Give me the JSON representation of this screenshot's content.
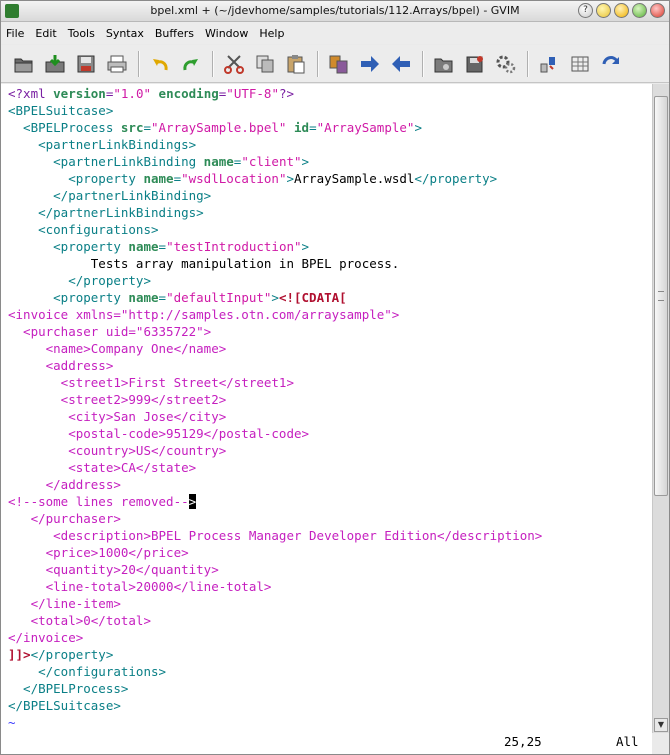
{
  "window": {
    "title": "bpel.xml + (~/jdevhome/samples/tutorials/112.Arrays/bpel) - GVIM"
  },
  "menu": [
    {
      "label": "File"
    },
    {
      "label": "Edit"
    },
    {
      "label": "Tools"
    },
    {
      "label": "Syntax"
    },
    {
      "label": "Buffers"
    },
    {
      "label": "Window"
    },
    {
      "label": "Help"
    }
  ],
  "toolbar_icons": [
    "open-icon",
    "save-icon",
    "save-all-icon",
    "print-icon",
    "undo-icon",
    "redo-icon",
    "cut-icon",
    "copy-icon",
    "paste-icon",
    "find-replace-icon",
    "find-next-icon",
    "find-previous-icon",
    "load-session-icon",
    "save-session-icon",
    "run-script-icon",
    "make-icon",
    "shell-icon",
    "tag-jump-icon"
  ],
  "editor": {
    "lines": [
      [
        [
          "t-decl",
          "<?xml "
        ],
        [
          "t-attr",
          "version"
        ],
        [
          "t-decl",
          "="
        ],
        [
          "t-str",
          "\"1.0\""
        ],
        [
          "t-decl",
          " "
        ],
        [
          "t-attr",
          "encoding"
        ],
        [
          "t-decl",
          "="
        ],
        [
          "t-str",
          "\"UTF-8\""
        ],
        [
          "t-decl",
          "?>"
        ]
      ],
      [
        [
          "t-tag",
          "<BPELSuitcase>"
        ]
      ],
      [
        [
          "t-tag",
          "  <BPELProcess "
        ],
        [
          "t-attr",
          "src"
        ],
        [
          "t-tag",
          "="
        ],
        [
          "t-str",
          "\"ArraySample.bpel\""
        ],
        [
          "t-tag",
          " "
        ],
        [
          "t-attr",
          "id"
        ],
        [
          "t-tag",
          "="
        ],
        [
          "t-str",
          "\"ArraySample\""
        ],
        [
          "t-tag",
          ">"
        ]
      ],
      [
        [
          "t-tag",
          "    <partnerLinkBindings>"
        ]
      ],
      [
        [
          "t-tag",
          "      <partnerLinkBinding "
        ],
        [
          "t-attr",
          "name"
        ],
        [
          "t-tag",
          "="
        ],
        [
          "t-str",
          "\"client\""
        ],
        [
          "t-tag",
          ">"
        ]
      ],
      [
        [
          "t-tag",
          "        <property "
        ],
        [
          "t-attr",
          "name"
        ],
        [
          "t-tag",
          "="
        ],
        [
          "t-str",
          "\"wsdlLocation\""
        ],
        [
          "t-tag",
          ">"
        ],
        [
          "t-text",
          "ArraySample.wsdl"
        ],
        [
          "t-tag",
          "</property>"
        ]
      ],
      [
        [
          "t-tag",
          "      </partnerLinkBinding>"
        ]
      ],
      [
        [
          "t-tag",
          "    </partnerLinkBindings>"
        ]
      ],
      [
        [
          "t-tag",
          "    <configurations>"
        ]
      ],
      [
        [
          "t-tag",
          "      <property "
        ],
        [
          "t-attr",
          "name"
        ],
        [
          "t-tag",
          "="
        ],
        [
          "t-str",
          "\"testIntroduction\""
        ],
        [
          "t-tag",
          ">"
        ]
      ],
      [
        [
          "t-text",
          "           Tests array manipulation in BPEL process."
        ]
      ],
      [
        [
          "t-tag",
          "        </property>"
        ]
      ],
      [
        [
          "t-tag",
          "      <property "
        ],
        [
          "t-attr",
          "name"
        ],
        [
          "t-tag",
          "="
        ],
        [
          "t-str",
          "\"defaultInput\""
        ],
        [
          "t-tag",
          ">"
        ],
        [
          "t-cdata",
          "<![CDATA["
        ]
      ],
      [
        [
          "t-pink",
          "<invoice xmlns=\"http://samples.otn.com/arraysample\">"
        ]
      ],
      [
        [
          "t-pink",
          "  <purchaser uid=\"6335722\">"
        ]
      ],
      [
        [
          "t-pink",
          "     <name>Company One</name>"
        ]
      ],
      [
        [
          "t-pink",
          "     <address>"
        ]
      ],
      [
        [
          "t-pink",
          "       <street1>First Street</street1>"
        ]
      ],
      [
        [
          "t-pink",
          "       <street2>999</street2>"
        ]
      ],
      [
        [
          "t-pink",
          "        <city>San Jose</city>"
        ]
      ],
      [
        [
          "t-pink",
          "        <postal-code>95129</postal-code>"
        ]
      ],
      [
        [
          "t-pink",
          "        <country>US</country>"
        ]
      ],
      [
        [
          "t-pink",
          "        <state>CA</state>"
        ]
      ],
      [
        [
          "t-pink",
          "     </address>"
        ]
      ],
      [
        [
          "t-pink",
          "<!--some lines removed--"
        ],
        [
          "cursor",
          ">"
        ]
      ],
      [
        [
          "t-pink",
          "   </purchaser>"
        ]
      ],
      [
        [
          "t-pink",
          "      <description>BPEL Process Manager Developer Edition</description>"
        ]
      ],
      [
        [
          "t-pink",
          "     <price>1000</price>"
        ]
      ],
      [
        [
          "t-pink",
          "     <quantity>20</quantity>"
        ]
      ],
      [
        [
          "t-pink",
          "     <line-total>20000</line-total>"
        ]
      ],
      [
        [
          "t-pink",
          "   </line-item>"
        ]
      ],
      [
        [
          "t-pink",
          "   <total>0</total>"
        ]
      ],
      [
        [
          "t-pink",
          "</invoice>"
        ]
      ],
      [
        [
          "t-cdata",
          "]]>"
        ],
        [
          "t-tag",
          "</property>"
        ]
      ],
      [
        [
          "t-tag",
          "    </configurations>"
        ]
      ],
      [
        [
          "t-tag",
          "  </BPELProcess>"
        ]
      ],
      [
        [
          "t-tag",
          "</BPELSuitcase>"
        ]
      ],
      [
        [
          "t-tilde",
          "~"
        ]
      ]
    ]
  },
  "status": {
    "position": "25,25",
    "scroll": "All"
  }
}
